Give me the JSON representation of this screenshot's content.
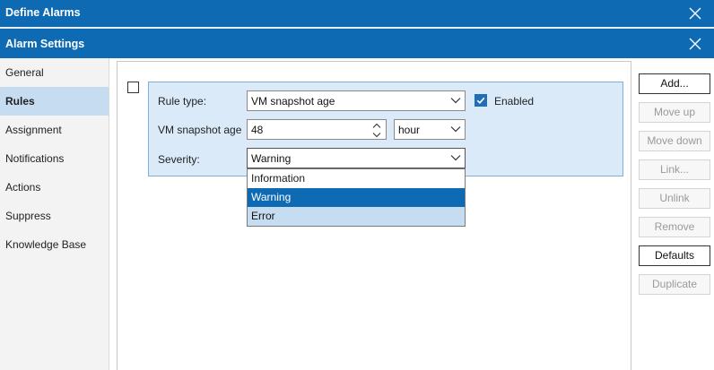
{
  "window": {
    "outer_title": "Define Alarms",
    "inner_title": "Alarm Settings"
  },
  "nav": {
    "items": [
      {
        "label": "General"
      },
      {
        "label": "Rules"
      },
      {
        "label": "Assignment"
      },
      {
        "label": "Notifications"
      },
      {
        "label": "Actions"
      },
      {
        "label": "Suppress"
      },
      {
        "label": "Knowledge Base"
      }
    ],
    "active": "Rules"
  },
  "rule": {
    "rule_type_label": "Rule type:",
    "rule_type_value": "VM snapshot age",
    "enabled_label": "Enabled",
    "enabled_checked": true,
    "age_label": "VM snapshot age",
    "age_value": "48",
    "age_unit": "hour",
    "severity_label": "Severity:",
    "severity_value": "Warning",
    "severity_options": [
      "Information",
      "Warning",
      "Error"
    ]
  },
  "buttons": {
    "add": "Add...",
    "move_up": "Move up",
    "move_down": "Move down",
    "link": "Link...",
    "unlink": "Unlink",
    "remove": "Remove",
    "defaults": "Defaults",
    "duplicate": "Duplicate"
  },
  "colors": {
    "titlebar": "#0f6ab4",
    "nav_active": "#c6dcf0",
    "rule_panel": "#dbeaf8",
    "selected_option": "#0f6ab4"
  }
}
